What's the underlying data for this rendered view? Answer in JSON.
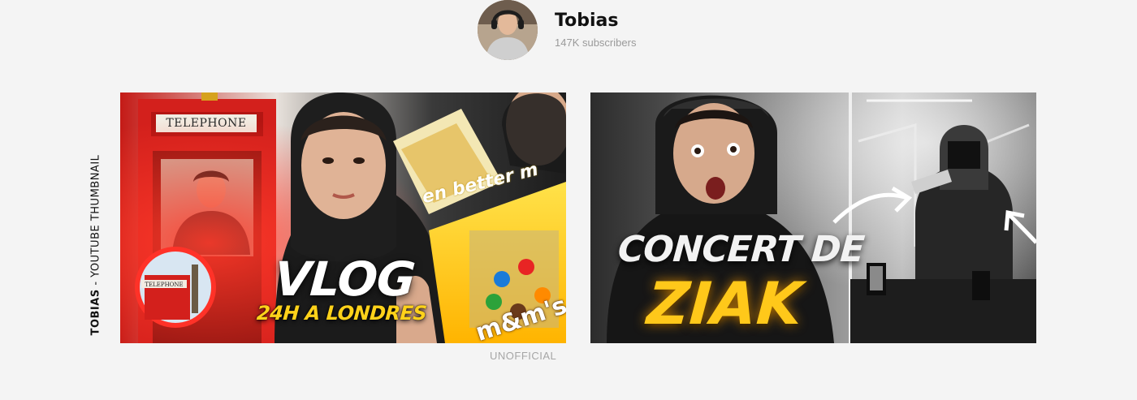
{
  "channel": {
    "name": "Tobias",
    "subscribers": "147K subscribers"
  },
  "side_label": {
    "strong": "TOBIAS",
    "rest": " - YOUTUBE THUMBNAIL"
  },
  "thumbnails": [
    {
      "title": "VLOG",
      "subtitle": "24H A LONDRES",
      "sign": "TELEPHONE",
      "small_sign": "TELEPHONE",
      "brand_text": "en better m",
      "candy_text": "m&m's"
    },
    {
      "title": "CONCERT DE",
      "name": "ZIAK"
    }
  ],
  "footer": {
    "unofficial": "UNOFFICIAL"
  },
  "colors": {
    "background": "#f4f4f4",
    "accent_yellow": "#ffd21a",
    "phone_red": "#d3201c",
    "concert_gold": "#ffc81a"
  }
}
